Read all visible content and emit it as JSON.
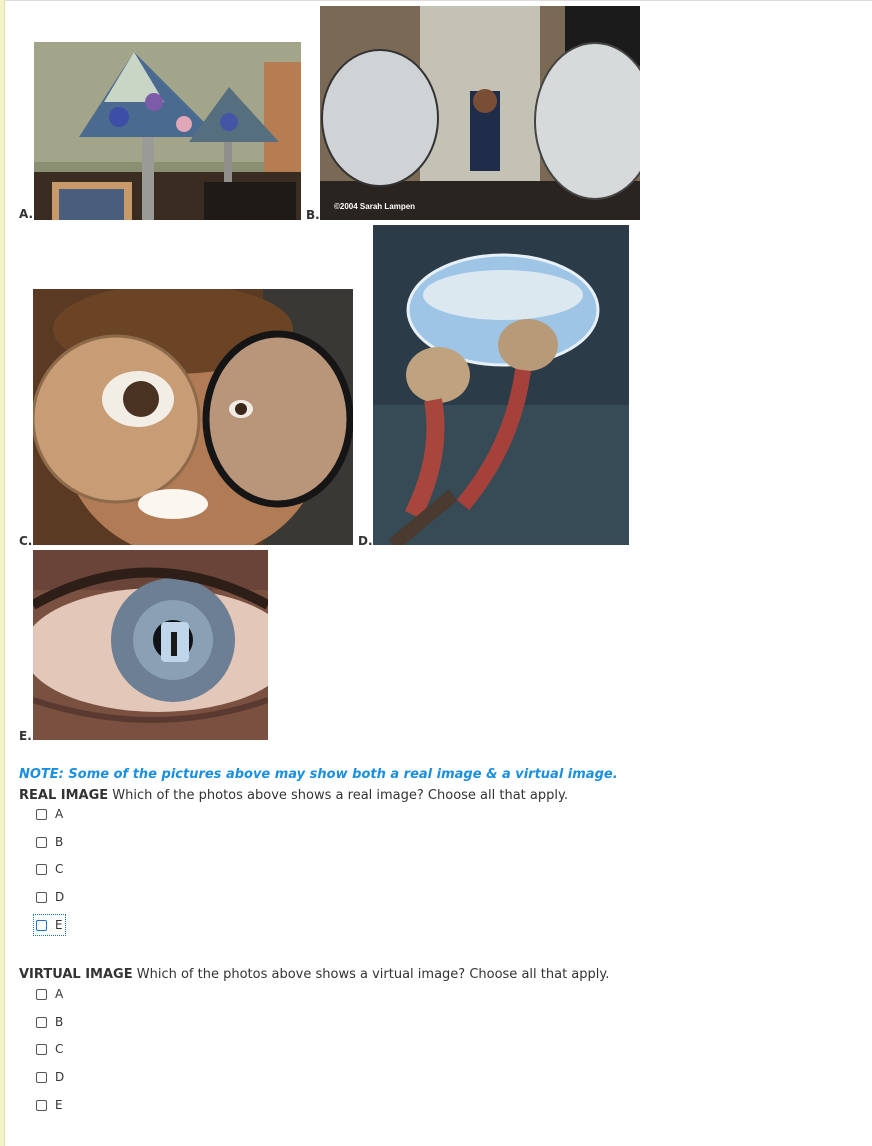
{
  "photos": [
    {
      "label": "A.",
      "subject": "stained-glass-lamps-photo"
    },
    {
      "label": "B.",
      "subject": "convex-mirrors-photo",
      "credit": "©2004 Sarah Lampen"
    },
    {
      "label": "C.",
      "subject": "magnifying-lenses-face-photo"
    },
    {
      "label": "D.",
      "subject": "water-drop-on-buds-photo"
    },
    {
      "label": "E.",
      "subject": "eye-reflection-photo"
    }
  ],
  "note": "NOTE: Some of the pictures above may show both a real image & a virtual image.",
  "questions": [
    {
      "heading": "REAL IMAGE",
      "prompt": " Which of the photos above shows a real image? Choose all that apply.",
      "options": [
        "A",
        "B",
        "C",
        "D",
        "E"
      ],
      "focused_option": "E"
    },
    {
      "heading": "VIRTUAL IMAGE",
      "prompt": " Which of the photos above shows a virtual image? Choose all that apply.",
      "options": [
        "A",
        "B",
        "C",
        "D",
        "E"
      ]
    }
  ],
  "colors": {
    "note": "#1a8fe0",
    "text": "#333333",
    "focus": "#1a6fd0"
  }
}
